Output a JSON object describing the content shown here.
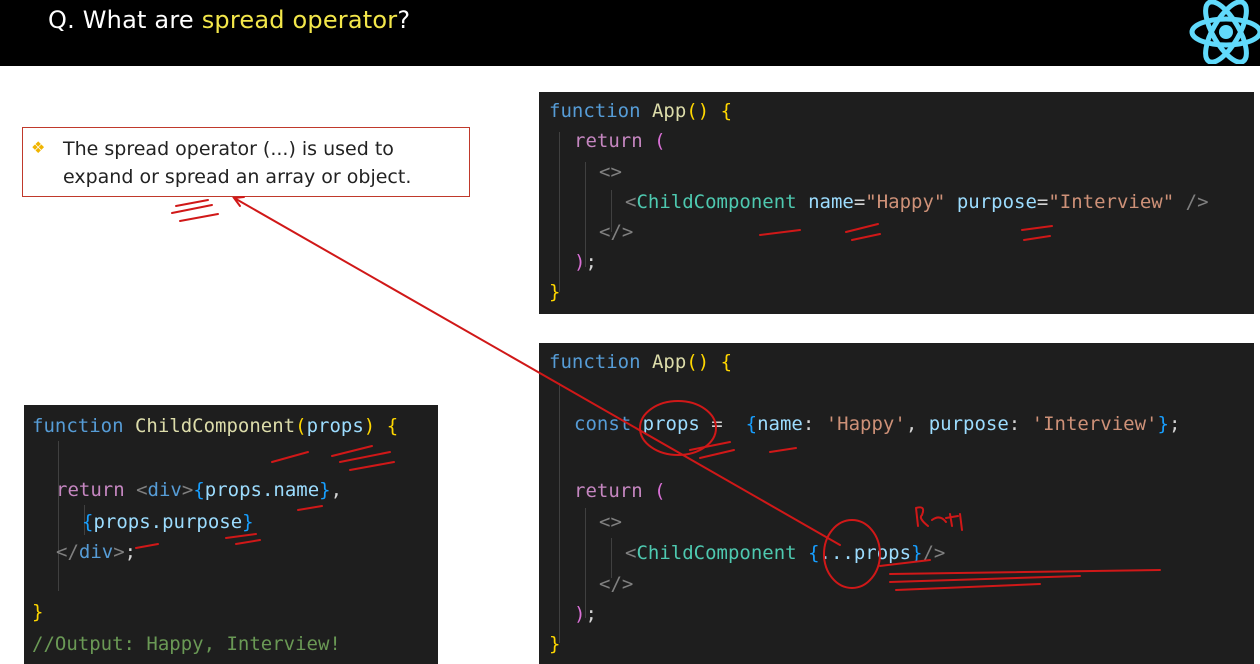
{
  "header": {
    "title_prefix": "Q. What are ",
    "title_highlight": "spread operator",
    "title_suffix": "?",
    "logo_icon": "react-logo-icon"
  },
  "note": {
    "line1": "The spread operator (...) is used to",
    "line2": "expand or spread an array or object."
  },
  "code_child": {
    "l1_kw": "function",
    "l1_fn": "ChildComponent",
    "l1_param": "props",
    "l2_kw": "return",
    "l2_tag": "div",
    "l2_expr": "props.name",
    "l3_expr": "props.purpose",
    "l4_tag": "div",
    "l6_comment": "//Output: Happy, Interview!"
  },
  "code_app1": {
    "l1_kw": "function",
    "l1_fn": "App",
    "l2_kw": "return",
    "l4_tag": "ChildComponent",
    "l4_attr1": "name",
    "l4_val1": "\"Happy\"",
    "l4_attr2": "purpose",
    "l4_val2": "\"Interview\""
  },
  "code_app2": {
    "l1_kw": "function",
    "l1_fn": "App",
    "l2_kw": "const",
    "l2_var": "props",
    "l2_k1": "name",
    "l2_v1": "'Happy'",
    "l2_k2": "purpose",
    "l2_v2": "'Interview'",
    "l3_kw": "return",
    "l5_tag": "ChildComponent",
    "l5_spread": "...props"
  },
  "annotations": {
    "handwritten_note": "Rpt"
  },
  "colors": {
    "header_bg": "#000000",
    "title_highlight": "#f3e74a",
    "code_bg": "#1e1e1e",
    "annotation_red": "#c0392b"
  }
}
